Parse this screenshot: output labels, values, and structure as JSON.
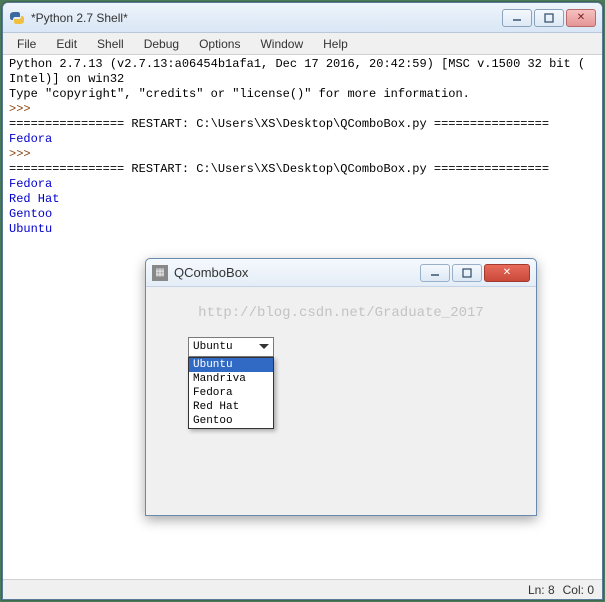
{
  "outer": {
    "title": "*Python 2.7 Shell*",
    "menus": [
      "File",
      "Edit",
      "Shell",
      "Debug",
      "Options",
      "Window",
      "Help"
    ]
  },
  "shell": {
    "header1": "Python 2.7.13 (v2.7.13:a06454b1afa1, Dec 17 2016, 20:42:59) [MSC v.1500 32 bit (",
    "header2": "Intel)] on win32",
    "header3": "Type \"copyright\", \"credits\" or \"license()\" for more information.",
    "prompt": ">>> ",
    "restart1": "================ RESTART: C:\\Users\\XS\\Desktop\\QComboBox.py ================",
    "out1": [
      "Fedora"
    ],
    "restart2": "================ RESTART: C:\\Users\\XS\\Desktop\\QComboBox.py ================",
    "out2": [
      "Fedora",
      "Red Hat",
      "Gentoo",
      "Ubuntu"
    ]
  },
  "status": {
    "ln": "Ln: 8",
    "col": "Col: 0"
  },
  "inner": {
    "title": "QComboBox",
    "watermark": "http://blog.csdn.net/Graduate_2017",
    "combo": {
      "selected": "Ubuntu",
      "options": [
        "Ubuntu",
        "Mandriva",
        "Fedora",
        "Red Hat",
        "Gentoo"
      ]
    }
  },
  "icons": {
    "close_x": "✕"
  }
}
